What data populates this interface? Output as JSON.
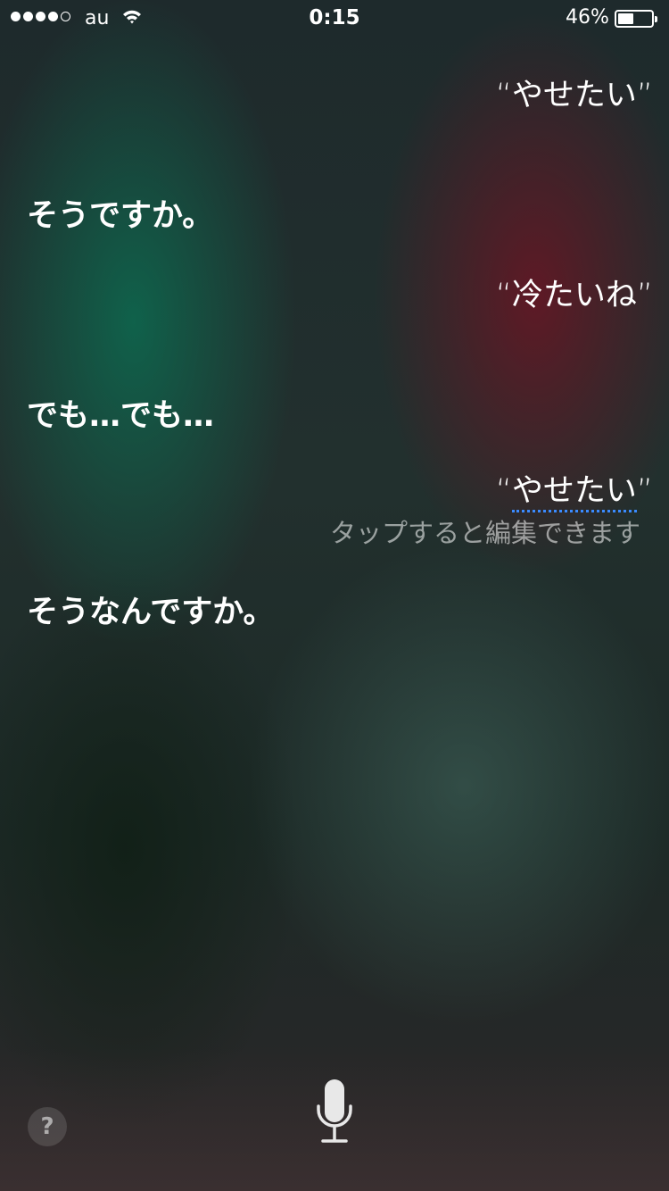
{
  "status_bar": {
    "carrier": "au",
    "time": "0:15",
    "battery_percent_label": "46%",
    "battery_level": 0.46,
    "signal_bars_filled": 4,
    "signal_bars_total": 5
  },
  "conversation": [
    {
      "speaker": "user",
      "text": "“やせたい”"
    },
    {
      "speaker": "siri",
      "text": "そうですか。"
    },
    {
      "speaker": "user",
      "text": "“冷たいね”"
    },
    {
      "speaker": "siri",
      "text": "でも…でも…"
    },
    {
      "speaker": "user",
      "open_quote": "“",
      "text": "やせたい",
      "close_quote": "”",
      "editable_hint": "タップすると編集できます"
    },
    {
      "speaker": "siri",
      "text": "そうなんですか。"
    }
  ],
  "controls": {
    "help_label": "?",
    "help_icon": "question-icon",
    "mic_icon": "microphone-icon"
  },
  "colors": {
    "edit_underline": "#3a8bff",
    "text": "#ffffff"
  }
}
